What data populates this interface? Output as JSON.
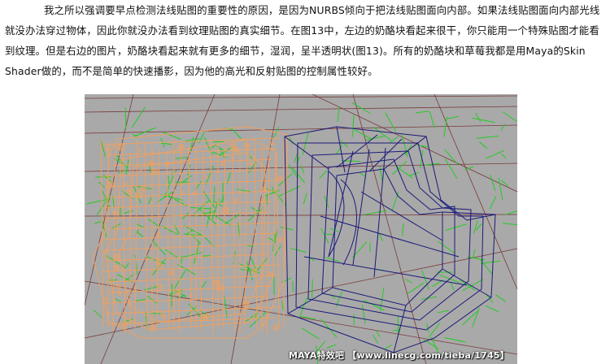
{
  "article": {
    "paragraph": "我之所以强调要早点检测法线贴图的重要性的原因，是因为NURBS倾向于把法线贴图面向内部。如果法线贴图面向内部光线就没办法穿过物体，因此你就没办法看到纹理贴图的真实细节。在图13中，左边的奶酪块看起来很干，你只能用一个特殊贴图才能看到纹理。但是右边的图片，奶酪块看起来就有更多的细节，湿润，呈半透明状(图13)。所有的奶酪块和草莓我都是用Maya的Skin Shader做的，而不是简单的快速播影，因为他的高光和反射贴图的控制属性较好。"
  },
  "figure": {
    "watermark": "MAYA特效吧 【www.linecg.com/tieba/1745】",
    "colors": {
      "background": "#a9a9a9",
      "left_wireframe": "#f0a060",
      "right_wireframe": "#1a1a7a",
      "normals": "#22cc22",
      "grid": "#7a3a3a"
    }
  }
}
